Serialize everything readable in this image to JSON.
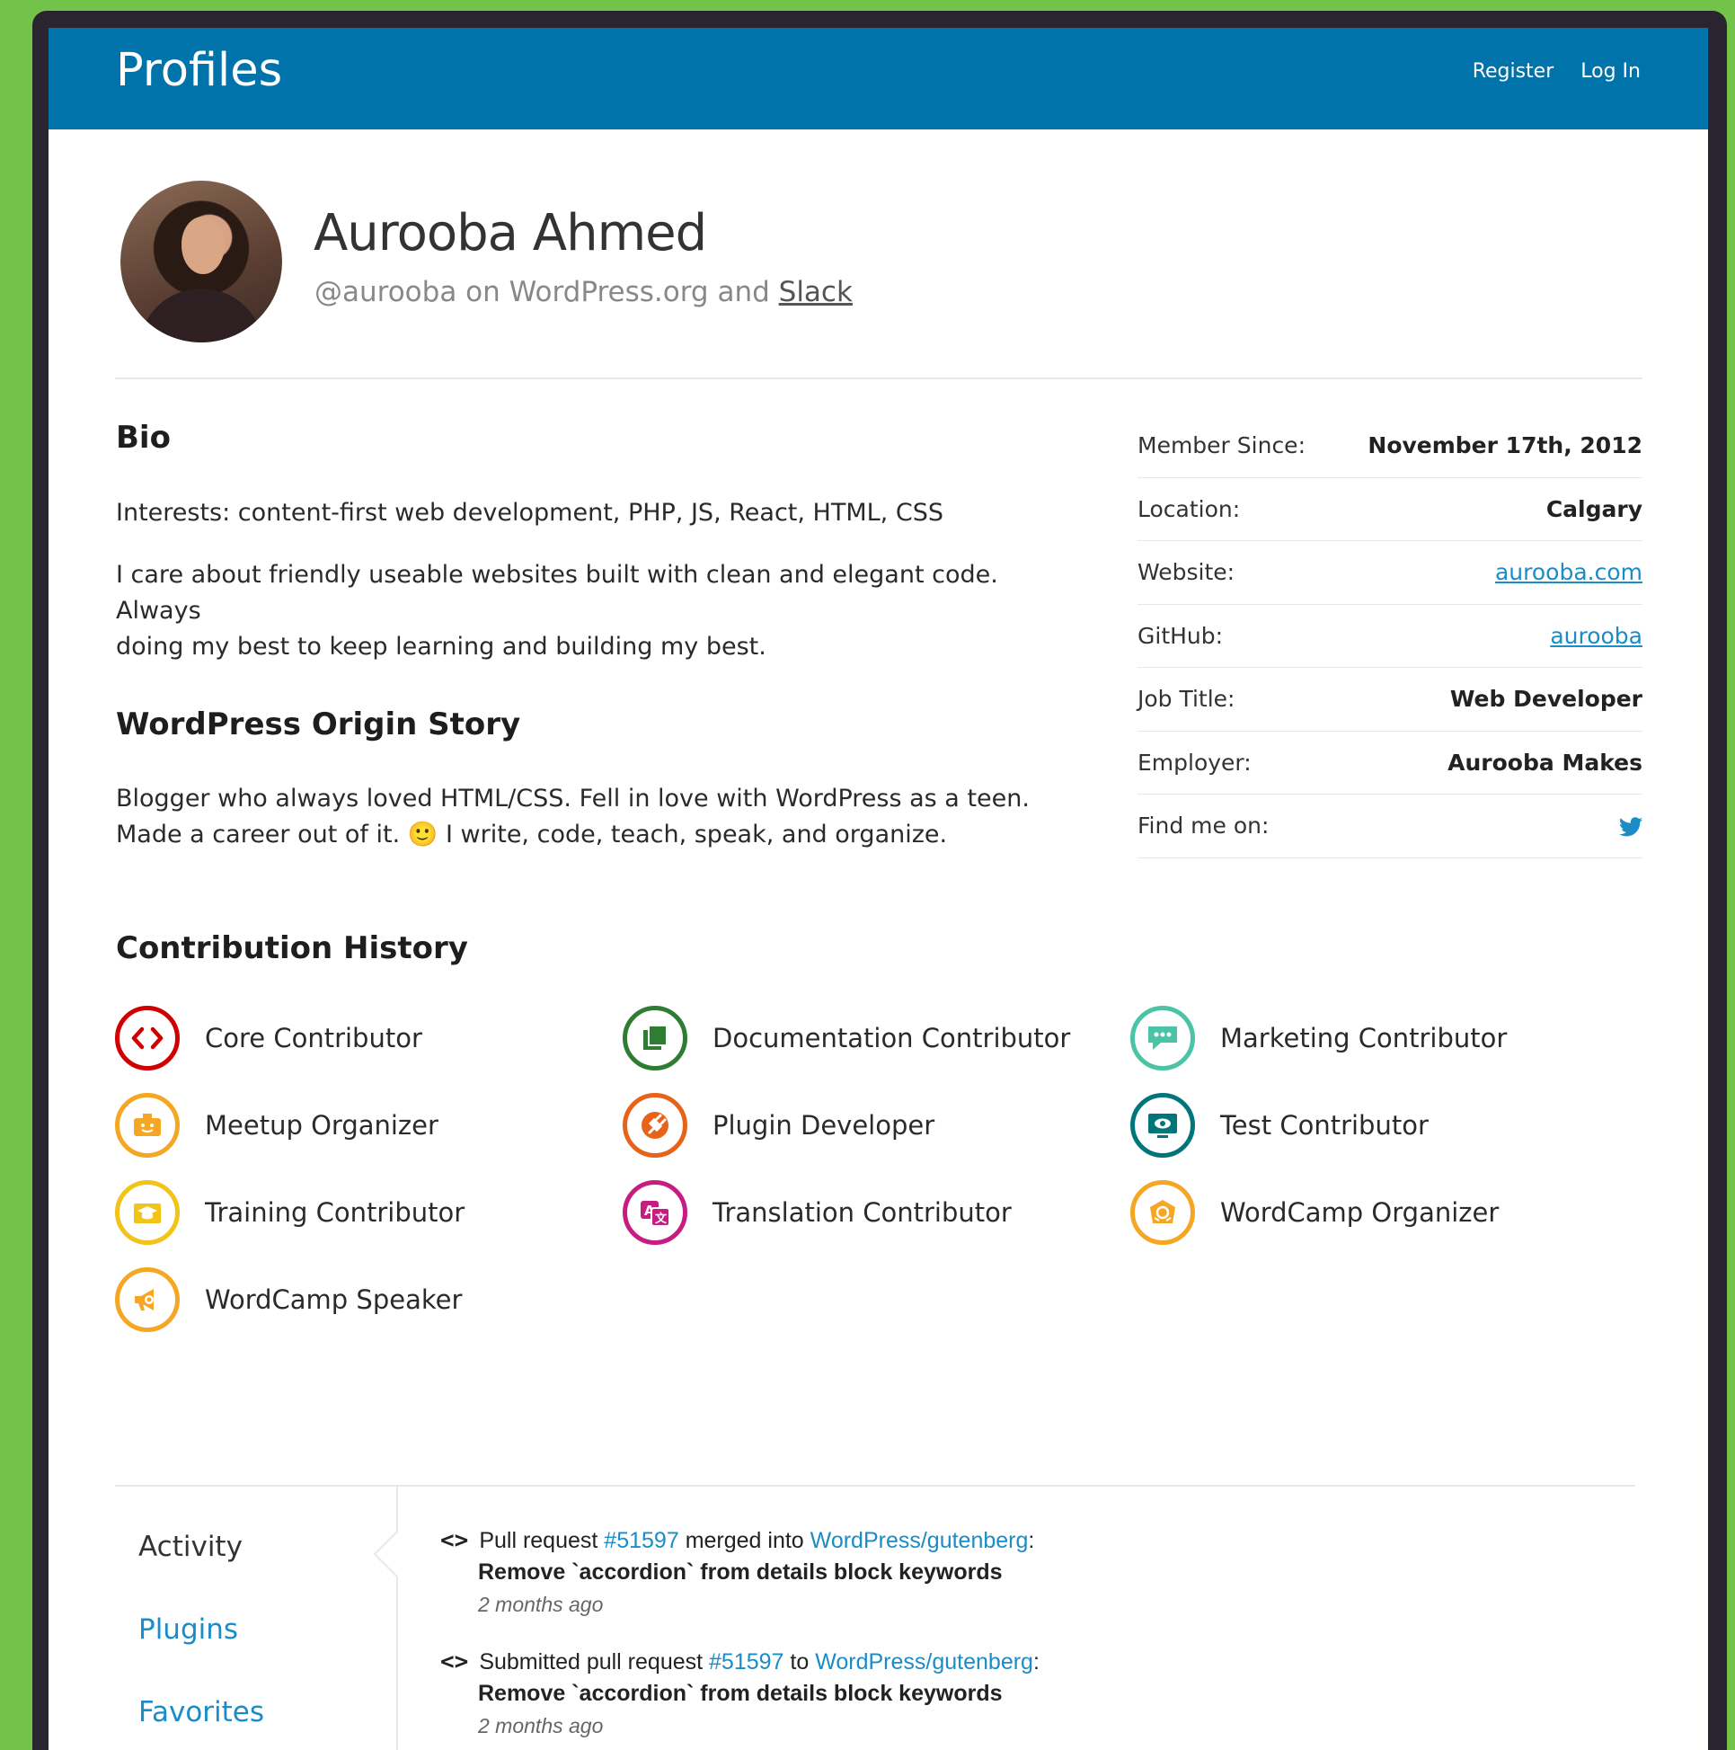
{
  "header": {
    "title": "Profiles",
    "nav": [
      "Register",
      "Log In"
    ]
  },
  "profile": {
    "name": "Aurooba Ahmed",
    "handle_text": "@aurooba on WordPress.org and",
    "slack_link": "Slack"
  },
  "bio": {
    "heading": "Bio",
    "p1": "Interests: content-first web development, PHP, JS, React, HTML, CSS",
    "p2_line1": "I care about friendly useable websites built with clean and elegant code. Always",
    "p2_line2": "doing my best to keep learning and building my best."
  },
  "origin": {
    "heading": "WordPress Origin Story",
    "line1": "Blogger who always loved HTML/CSS. Fell in love with WordPress as a teen.",
    "line2_a": "Made a career out of it.",
    "emoji": "🙂",
    "line2_b": "I write, code, teach, speak, and organize."
  },
  "meta": [
    {
      "label": "Member Since:",
      "value": "November 17th, 2012",
      "type": "text"
    },
    {
      "label": "Location:",
      "value": "Calgary",
      "type": "text"
    },
    {
      "label": "Website:",
      "value": "aurooba.com",
      "type": "link"
    },
    {
      "label": "GitHub:",
      "value": "aurooba",
      "type": "link"
    },
    {
      "label": "Job Title:",
      "value": "Web Developer",
      "type": "text"
    },
    {
      "label": "Employer:",
      "value": "Aurooba Makes",
      "type": "text"
    },
    {
      "label": "Find me on:",
      "value": "twitter-icon",
      "type": "icon"
    }
  ],
  "contributions": {
    "heading": "Contribution History",
    "badges": [
      {
        "label": "Core Contributor",
        "color": "#d00000",
        "icon": "code-icon"
      },
      {
        "label": "Documentation Contributor",
        "color": "#2e7d32",
        "icon": "document-icon"
      },
      {
        "label": "Marketing Contributor",
        "color": "#4ac3a6",
        "icon": "chat-bubble-icon"
      },
      {
        "label": "Meetup Organizer",
        "color": "#f5a623",
        "icon": "id-card-icon"
      },
      {
        "label": "Plugin Developer",
        "color": "#e8631a",
        "icon": "plug-icon"
      },
      {
        "label": "Test Contributor",
        "color": "#00757a",
        "icon": "screen-icon"
      },
      {
        "label": "Training Contributor",
        "color": "#f2c318",
        "icon": "graduation-cap-icon"
      },
      {
        "label": "Translation Contributor",
        "color": "#c71d83",
        "icon": "translate-icon"
      },
      {
        "label": "WordCamp Organizer",
        "color": "#f5a623",
        "icon": "wordcamp-icon"
      },
      {
        "label": "WordCamp Speaker",
        "color": "#f5a623",
        "icon": "megaphone-icon"
      }
    ]
  },
  "tabs": [
    {
      "label": "Activity",
      "active": true
    },
    {
      "label": "Plugins",
      "active": false
    },
    {
      "label": "Favorites",
      "active": false
    }
  ],
  "activity": [
    {
      "prefix": "Pull request",
      "pr": "#51597",
      "middle": "merged into",
      "repo": "WordPress/gutenberg",
      "suffix": ":",
      "title": "Remove `accordion` from details block keywords",
      "time": "2 months ago"
    },
    {
      "prefix": "Submitted pull request",
      "pr": "#51597",
      "middle": "to",
      "repo": "WordPress/gutenberg",
      "suffix": ":",
      "title": "Remove `accordion` from details block keywords",
      "time": "2 months ago"
    }
  ],
  "colors": {
    "brand": "#0073aa",
    "link": "#1a8cc7",
    "page_bg": "#73c24a"
  }
}
